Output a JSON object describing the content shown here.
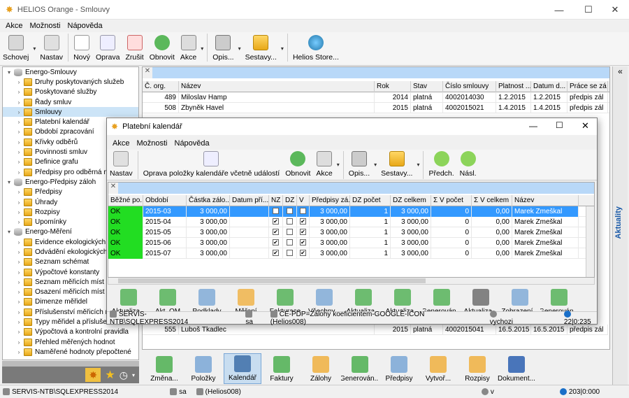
{
  "main": {
    "title": "HELIOS Orange - Smlouvy",
    "menu": [
      "Akce",
      "Možnosti",
      "Nápověda"
    ],
    "toolbar": [
      "Schovej",
      "Nastav",
      "Nový",
      "Oprava",
      "Zrušit",
      "Obnovit",
      "Akce",
      "Opis...",
      "Sestavy...",
      "Helios Store..."
    ],
    "tree": [
      {
        "label": "Energo-Smlouvy",
        "level": 0,
        "type": "db"
      },
      {
        "label": "Druhy poskytovaných služeb",
        "level": 1
      },
      {
        "label": "Poskytované služby",
        "level": 1
      },
      {
        "label": "Řady smluv",
        "level": 1
      },
      {
        "label": "Smlouvy",
        "level": 1,
        "selected": true
      },
      {
        "label": "Platební kalendář",
        "level": 1
      },
      {
        "label": "Období zpracování",
        "level": 1
      },
      {
        "label": "Křivky odběrů",
        "level": 1
      },
      {
        "label": "Povinnosti smluv",
        "level": 1
      },
      {
        "label": "Definice grafu",
        "level": 1
      },
      {
        "label": "Předpisy pro odběrná m",
        "level": 1
      },
      {
        "label": "Energo-Předpisy záloh",
        "level": 0,
        "type": "db"
      },
      {
        "label": "Předpisy",
        "level": 1
      },
      {
        "label": "Úhrady",
        "level": 1
      },
      {
        "label": "Rozpisy",
        "level": 1
      },
      {
        "label": "Upomínky",
        "level": 1
      },
      {
        "label": "Energo-Měření",
        "level": 0,
        "type": "db"
      },
      {
        "label": "Evidence ekologických",
        "level": 1
      },
      {
        "label": "Odvádění ekologických",
        "level": 1
      },
      {
        "label": "Seznam schémat",
        "level": 1
      },
      {
        "label": "Výpočtové konstanty",
        "level": 1
      },
      {
        "label": "Seznam měřicích míst",
        "level": 1
      },
      {
        "label": "Osazení měřicích míst (r",
        "level": 1
      },
      {
        "label": "Dimenze měřidel",
        "level": 1
      },
      {
        "label": "Příslušenství měřicích m",
        "level": 1
      },
      {
        "label": "Typy měřidel a příslušen",
        "level": 1
      },
      {
        "label": "Výpočtová a kontrolní pravidla",
        "level": 1
      },
      {
        "label": "Přehled měřených hodnot",
        "level": 1
      },
      {
        "label": "Naměřené hodnoty přepočtené",
        "level": 1
      }
    ],
    "grid_headers": [
      "Č. org.",
      "Název",
      "Rok",
      "Stav",
      "Číslo smlouvy",
      "Platnost ...",
      "Datum d...",
      "Práce se zá"
    ],
    "grid_rows": [
      [
        "489",
        "Miloslav Hamp",
        "2014",
        "platná",
        "4002014030",
        "1.2.2015",
        "1.2.2015",
        "předpis zál"
      ],
      [
        "508",
        "Zbyněk Havel",
        "2015",
        "platná",
        "4002015021",
        "1.4.2015",
        "1.4.2015",
        "předpis zál"
      ]
    ],
    "grid_bottom_row": [
      "555",
      "Luboš Tkadlec",
      "2015",
      "platná",
      "4002015041",
      "16.5.2015",
      "16.5.2015",
      "předpis zál"
    ],
    "bottom_buttons": [
      "Změna...",
      "Položky",
      "Kalendář",
      "Faktury",
      "Zálohy",
      "Generován...",
      "Předpisy",
      "Vytvoř...",
      "Rozpisy",
      "Dokument..."
    ],
    "status": [
      "SERVIS-NTB\\SQLEXPRESS2014",
      "sa",
      "(Helios008)",
      "v",
      "203|0:000"
    ],
    "side_tab": "Aktuality",
    "side_chevron": "«"
  },
  "dialog": {
    "title": "Platební kalendář",
    "menu": [
      "Akce",
      "Možnosti",
      "Nápověda"
    ],
    "toolbar": [
      "Nastav",
      "Oprava položky kalendáře včetně událostí",
      "Obnovit",
      "Akce",
      "Opis...",
      "Sestavy...",
      "Předch.",
      "Násl."
    ],
    "headers": [
      "Běžné po...",
      "Období",
      "Částka zálo...",
      "Datum pří...",
      "NZ",
      "DZ",
      "V",
      "Předpisy zá...",
      "DZ počet",
      "DZ celkem",
      "Σ V počet",
      "Σ V celkem",
      "Název"
    ],
    "rows": [
      [
        "OK",
        "2015-03",
        "3 000,00",
        "",
        "✔",
        "",
        "✔",
        "3 000,00",
        "1",
        "3 000,00",
        "0",
        "0,00",
        "Marek Zmeškal"
      ],
      [
        "OK",
        "2015-04",
        "3 000,00",
        "",
        "✔",
        "",
        "✔",
        "3 000,00",
        "1",
        "3 000,00",
        "0",
        "0,00",
        "Marek Zmeškal"
      ],
      [
        "OK",
        "2015-05",
        "3 000,00",
        "",
        "✔",
        "",
        "✔",
        "3 000,00",
        "1",
        "3 000,00",
        "0",
        "0,00",
        "Marek Zmeškal"
      ],
      [
        "OK",
        "2015-06",
        "3 000,00",
        "",
        "✔",
        "",
        "✔",
        "3 000,00",
        "1",
        "3 000,00",
        "0",
        "0,00",
        "Marek Zmeškal"
      ],
      [
        "OK",
        "2015-07",
        "3 000,00",
        "",
        "✔",
        "",
        "✔",
        "3 000,00",
        "1",
        "3 000,00",
        "0",
        "0,00",
        "Marek Zmeškal"
      ]
    ],
    "bottom_buttons": [
      "Aktualiza...",
      "Akt. OM",
      "Podklady",
      "Měření",
      "Fakturace",
      "Všechny...",
      "Aktualiza...",
      "Aktualiza...",
      "Generován...",
      "Aktualiza...",
      "Zobrazení...",
      "Generován..."
    ],
    "status": [
      "SERVIS-NTB\\SQLEXPRESS2014",
      "sa",
      "CE-PDP=Zálohy koeficientem-GOOGLE-ICON (Helios008)",
      "vychozi",
      "22|0:235"
    ]
  },
  "colors": {
    "accent": "#3399ff",
    "ok": "#22dd22",
    "filter": "#b8d8f8"
  }
}
